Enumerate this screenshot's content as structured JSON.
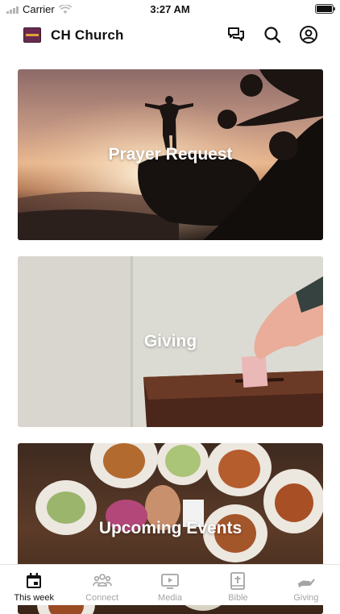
{
  "status_bar": {
    "carrier": "Carrier",
    "time": "3:27 AM"
  },
  "header": {
    "title": "CH Church",
    "icons": [
      "messages-icon",
      "search-icon",
      "profile-icon"
    ]
  },
  "cards": [
    {
      "label": "Prayer Request"
    },
    {
      "label": "Giving"
    },
    {
      "label": "Upcoming Events"
    }
  ],
  "tabs": [
    {
      "label": "This week",
      "icon": "calendar-icon",
      "active": true
    },
    {
      "label": "Connect",
      "icon": "people-icon",
      "active": false
    },
    {
      "label": "Media",
      "icon": "play-icon",
      "active": false
    },
    {
      "label": "Bible",
      "icon": "bible-icon",
      "active": false
    },
    {
      "label": "Giving",
      "icon": "giving-hand-icon",
      "active": false
    }
  ],
  "colors": {
    "active_tab": "#111111",
    "inactive_tab": "#a4a4a4"
  }
}
